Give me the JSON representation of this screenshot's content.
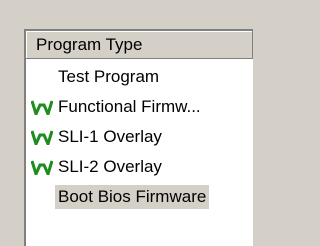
{
  "list": {
    "header": "Program Type",
    "items": [
      {
        "label": "Test Program",
        "icon": "none"
      },
      {
        "label": "Functional Firmw...",
        "icon": "w-icon"
      },
      {
        "label": "SLI-1 Overlay",
        "icon": "w-icon"
      },
      {
        "label": "SLI-2 Overlay",
        "icon": "w-icon"
      },
      {
        "label": "Boot Bios Firmware",
        "icon": "none"
      }
    ]
  },
  "colors": {
    "icon_green": "#1e8c1e",
    "background": "#d4d0c8",
    "list_background": "#ffffff"
  }
}
